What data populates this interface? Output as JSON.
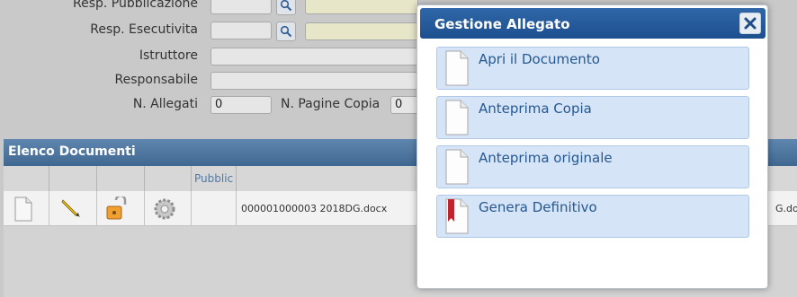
{
  "form": {
    "resp_pubblicazione_label": "Resp. Pubblicazione",
    "resp_esecutivita_label": "Resp. Esecutivita",
    "istruttore_label": "Istruttore",
    "responsabile_label": "Responsabile",
    "n_allegati_label": "N. Allegati",
    "n_allegati_value": "0",
    "n_pagine_copia_label": "N. Pagine Copia",
    "n_pagine_copia_value": "0"
  },
  "grid": {
    "title": "Elenco Documenti",
    "columns": [
      "Pubblic"
    ],
    "rows": [
      {
        "filename": "000001000003 2018DG.docx",
        "filename_tail": "G.docx"
      }
    ]
  },
  "dialog": {
    "title": "Gestione Allegato",
    "close_icon": "close-icon",
    "options": [
      {
        "label": "Apri il Documento",
        "icon": "document-icon"
      },
      {
        "label": "Anteprima Copia",
        "icon": "document-icon"
      },
      {
        "label": "Anteprima originale",
        "icon": "document-icon"
      },
      {
        "label": "Genera Definitivo",
        "icon": "bookmark-document-icon"
      }
    ]
  },
  "colors": {
    "dialog_header": "#2f67a8",
    "option_bg": "#d5e4f7",
    "option_text": "#26588f",
    "grid_header": "#4f789f"
  }
}
